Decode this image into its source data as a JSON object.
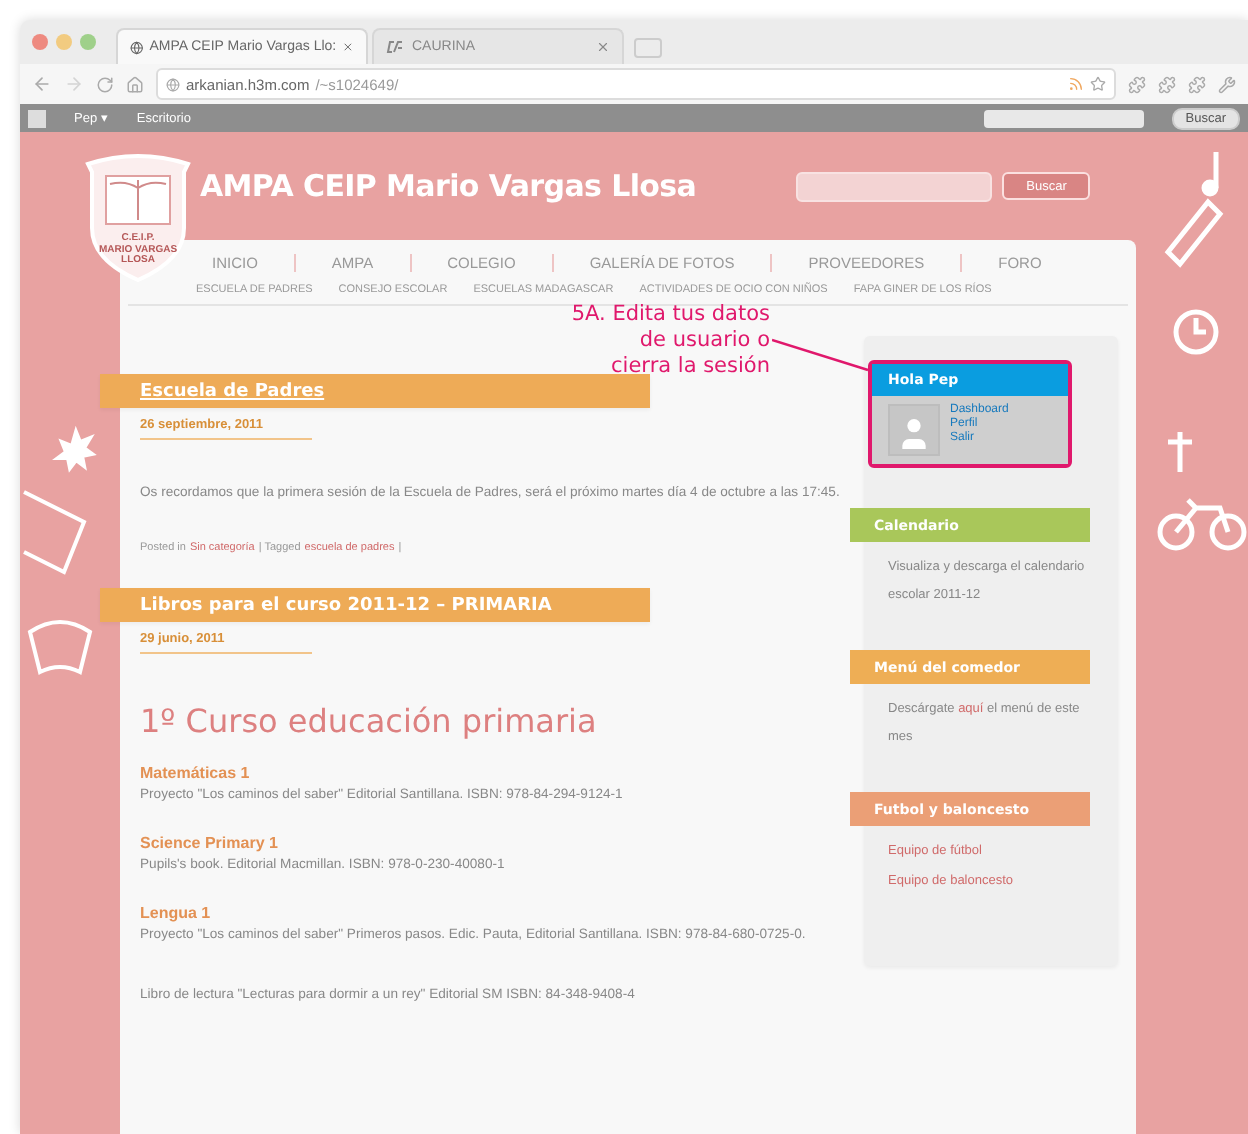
{
  "browser": {
    "tabs": [
      {
        "label": "AMPA CEIP Mario Vargas Llo:",
        "selected": true
      },
      {
        "label": "CAURINA",
        "selected": false
      }
    ],
    "url_host": "arkanian.h3m.com",
    "url_path": "/~s1024649/"
  },
  "admin_bar": {
    "user": "Pep ▾",
    "items": [
      "Escritorio"
    ],
    "search_button": "Buscar"
  },
  "site": {
    "title": "AMPA CEIP Mario Vargas Llosa",
    "logo_caption": [
      "C.E.I.P.",
      "MARIO VARGAS",
      "LLOSA"
    ],
    "search_button": "Buscar",
    "nav": [
      "INICIO",
      "AMPA",
      "COLEGIO",
      "GALERÍA DE FOTOS",
      "PROVEEDORES",
      "FORO"
    ],
    "subnav": [
      "ESCUELA DE PADRES",
      "CONSEJO ESCOLAR",
      "ESCUELAS MADAGASCAR",
      "ACTIVIDADES DE OCIO CON NIÑOS",
      "FAPA GINER DE LOS RÍOS"
    ]
  },
  "annotation": {
    "lines": [
      "5A. Edita tus datos",
      "de usuario o",
      "cierra la sesión"
    ]
  },
  "posts": [
    {
      "title": "Escuela de Padres",
      "date": "26 septiembre, 2011",
      "body": "Os recordamos que la primera sesión de la Escuela de Padres, será el próximo martes día 4 de octubre a las 17:45.",
      "meta": [
        {
          "text": "Posted in",
          "link": false
        },
        {
          "text": "Sin categoría",
          "link": true
        },
        {
          "text": "| Tagged",
          "link": false
        },
        {
          "text": "escuela de padres",
          "link": true
        },
        {
          "text": "|",
          "link": false
        }
      ]
    },
    {
      "title": "Libros para el curso 2011-12 – PRIMARIA",
      "date": "29 junio, 2011",
      "heading": "1º Curso educación primaria",
      "sections": [
        {
          "title": "Matemáticas 1",
          "text": "Proyecto \"Los caminos del saber\" Editorial Santillana. ISBN: 978-84-294-9124-1"
        },
        {
          "title": "Science Primary 1",
          "text": "Pupils's book. Editorial Macmillan. ISBN: 978-0-230-40080-1"
        },
        {
          "title": "Lengua 1",
          "text": "Proyecto \"Los caminos del saber\" Primeros pasos. Edic. Pauta, Editorial Santillana. ISBN: 978-84-680-0725-0."
        },
        {
          "text": "Libro de lectura \"Lecturas para dormir a un rey\" Editorial SM ISBN: 84-348-9408-4"
        }
      ]
    }
  ],
  "sidebar": [
    {
      "kind": "user",
      "title": "Hola Pep",
      "color": "#0a9de0",
      "links": [
        "Dashboard",
        "Perfil",
        "Salir"
      ]
    },
    {
      "kind": "text",
      "title": "Calendario",
      "color": "#a9c75a",
      "parts": [
        {
          "text": "Visualiza y descarga el calendario escolar 2011-12",
          "link": false
        }
      ]
    },
    {
      "kind": "text",
      "title": "Menú del comedor",
      "color": "#eeae55",
      "parts": [
        {
          "text": "Descárgate",
          "link": false
        },
        {
          "text": "aquí",
          "link": true
        },
        {
          "text": "el menú de este mes",
          "link": false
        }
      ]
    },
    {
      "kind": "links",
      "title": "Futbol y baloncesto",
      "color": "#eb9f76",
      "links": [
        "Equipo de fútbol",
        "Equipo de baloncesto"
      ]
    }
  ]
}
